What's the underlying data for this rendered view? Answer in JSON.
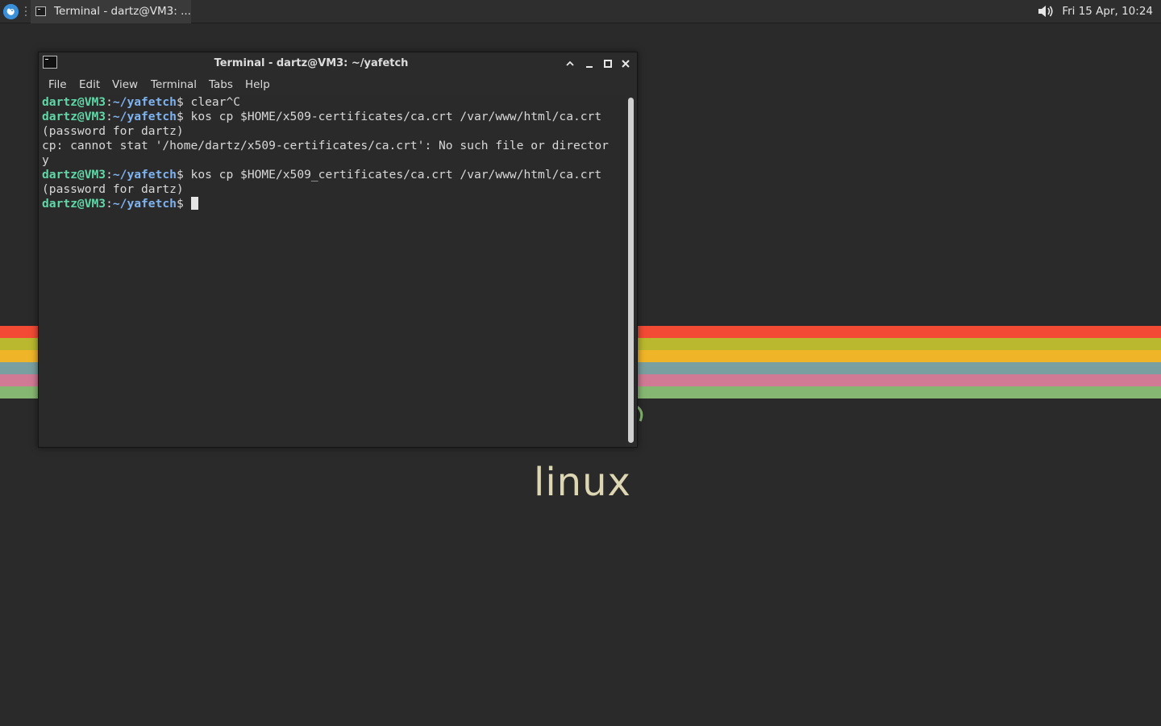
{
  "panel": {
    "taskbar_label": "Terminal - dartz@VM3: ...",
    "clock": "Fri 15 Apr, 10:24",
    "icons": [
      "app-menu-icon",
      "terminal-icon",
      "volume-icon"
    ]
  },
  "wallpaper": {
    "logo_text": "linux",
    "stripe_colors": [
      "#f24a35",
      "#b9b82e",
      "#f0b429",
      "#7a9fa0",
      "#d07a96",
      "#86b772"
    ]
  },
  "window": {
    "title": "Terminal - dartz@VM3: ~/yafetch",
    "menu": [
      "File",
      "Edit",
      "View",
      "Terminal",
      "Tabs",
      "Help"
    ]
  },
  "terminal": {
    "prompt_user": "dartz@VM3",
    "prompt_sep": ":",
    "prompt_path": "~/yafetch",
    "prompt_end": "$ ",
    "lines": [
      {
        "type": "cmd",
        "text": "clear^C"
      },
      {
        "type": "cmd",
        "text": "kos cp $HOME/x509-certificates/ca.crt /var/www/html/ca.crt"
      },
      {
        "type": "out",
        "text": "(password for dartz)"
      },
      {
        "type": "out",
        "text": "cp: cannot stat '/home/dartz/x509-certificates/ca.crt': No such file or director"
      },
      {
        "type": "out",
        "text": "y"
      },
      {
        "type": "cmd",
        "text": "kos cp $HOME/x509_certificates/ca.crt /var/www/html/ca.crt"
      },
      {
        "type": "out",
        "text": "(password for dartz)"
      },
      {
        "type": "cmd",
        "text": ""
      }
    ]
  },
  "colors": {
    "prompt_user": "#5fd7a7",
    "prompt_path": "#7fb3f0",
    "accent": "#3a8fd9"
  }
}
